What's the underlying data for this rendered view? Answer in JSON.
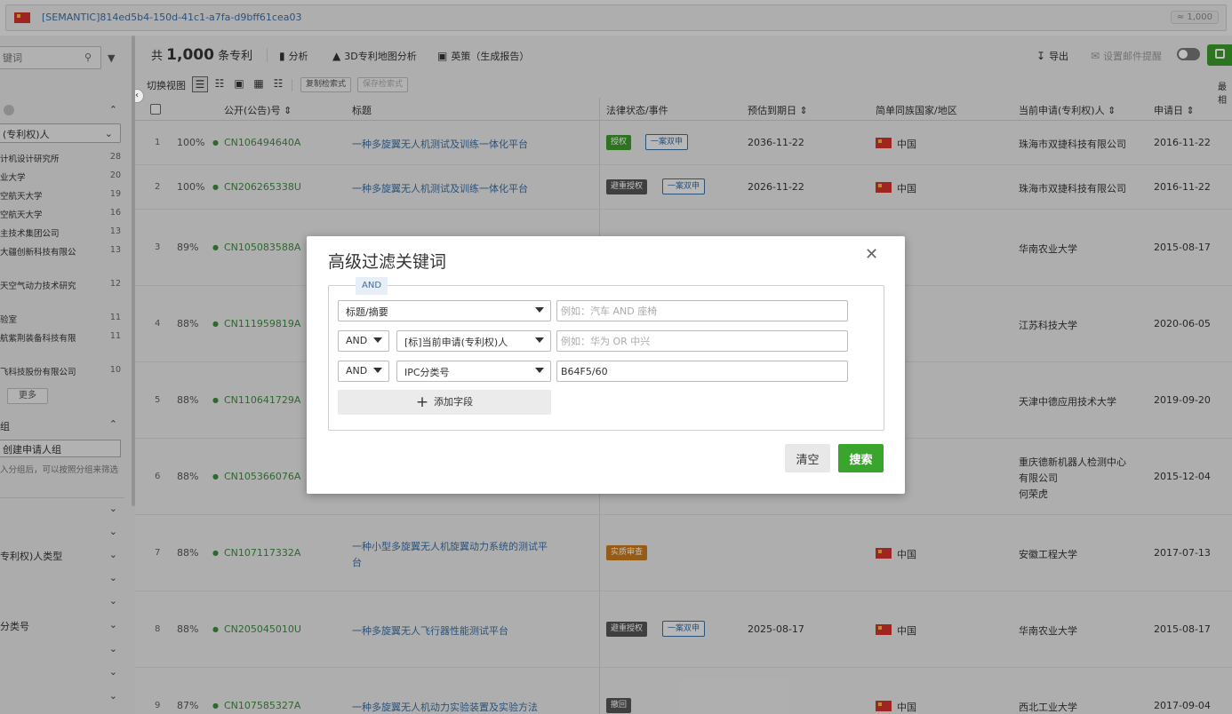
{
  "topbar": {
    "query": "[SEMANTIC]814ed5b4-150d-41c1-a7fa-d9bff61cea03",
    "count_badge": "≈ 1,000"
  },
  "sidebar": {
    "search_placeholder": "键词",
    "section1_title": "",
    "field_select": "(专利权)人",
    "items": [
      {
        "label": "计机设计研究所",
        "count": "28"
      },
      {
        "label": "业大学",
        "count": "20"
      },
      {
        "label": "空航天大学",
        "count": "19"
      },
      {
        "label": "空航天大学",
        "count": "16"
      },
      {
        "label": "主技术集团公司",
        "count": "13"
      },
      {
        "label": "大疆创新科技有限公",
        "count": "13"
      },
      {
        "label": "天空气动力技术研究",
        "count": "12"
      },
      {
        "label": "验室",
        "count": "11"
      },
      {
        "label": "航紫荆装备科技有限",
        "count": "11"
      },
      {
        "label": "飞科技股份有限公司",
        "count": "10"
      }
    ],
    "more_label": "更多",
    "group_title": "组",
    "group_input": "创建申请人组",
    "group_hint": "入分组后，可以按照分组来筛选",
    "collapsed": [
      "",
      "",
      "专利权)人类型",
      "",
      "",
      "分类号",
      "",
      "",
      ""
    ]
  },
  "toolbar": {
    "total_prefix": "共",
    "total_count": "1,000",
    "total_suffix": "条专利",
    "analysis": "分析",
    "map3d": "3D专利地图分析",
    "yingce": "英策（生成报告）",
    "export": "导出",
    "email_alert": "设置邮件提醒"
  },
  "viewbar": {
    "label": "切换视图",
    "copy_query": "复制检索式",
    "save_query": "保存检索式",
    "right_cut": "最相"
  },
  "table": {
    "headers": {
      "pn": "公开(公告)号",
      "title": "标题",
      "legal": "法律状态/事件",
      "expiry": "预估到期日",
      "family": "简单同族国家/地区",
      "applicant": "当前申请(专利权)人",
      "app_date": "申请日"
    },
    "rows": [
      {
        "idx": "1",
        "pct": "100%",
        "pn": "CN106494640A",
        "title": "一种多旋翼无人机测试及训练一体化平台",
        "title2": "",
        "tags": [
          {
            "t": "授权",
            "c": "green"
          },
          {
            "t": "一案双申",
            "c": "outline"
          }
        ],
        "expiry": "2036-11-22",
        "country": "中国",
        "applicant": [
          "珠海市双捷科技有限公司"
        ],
        "app_date": "2016-11-22"
      },
      {
        "idx": "2",
        "pct": "100%",
        "pn": "CN206265338U",
        "title": "一种多旋翼无人机测试及训练一体化平台",
        "title2": "",
        "tags": [
          {
            "t": "避重授权",
            "c": "gray"
          },
          {
            "t": "一案双申",
            "c": "outline"
          }
        ],
        "expiry": "2026-11-22",
        "country": "中国",
        "applicant": [
          "珠海市双捷科技有限公司"
        ],
        "app_date": "2016-11-22"
      },
      {
        "idx": "3",
        "pct": "89%",
        "pn": "CN105083588A",
        "title": "",
        "title2": "",
        "tags": [],
        "expiry": "",
        "country": "国",
        "applicant": [
          "华南农业大学"
        ],
        "app_date": "2015-08-17"
      },
      {
        "idx": "4",
        "pct": "88%",
        "pn": "CN111959819A",
        "title": "",
        "title2": "",
        "tags": [],
        "expiry": "",
        "country": "国",
        "applicant": [
          "江苏科技大学"
        ],
        "app_date": "2020-06-05"
      },
      {
        "idx": "5",
        "pct": "88%",
        "pn": "CN110641729A",
        "title": "",
        "title2": "",
        "tags": [],
        "expiry": "",
        "country": "国",
        "applicant": [
          "天津中德应用技术大学"
        ],
        "app_date": "2019-09-20"
      },
      {
        "idx": "6",
        "pct": "88%",
        "pn": "CN105366076A",
        "title": "",
        "title2": "",
        "tags": [],
        "expiry": "",
        "country": "国",
        "applicant": [
          "重庆德新机器人检测中心",
          "有限公司",
          "何荣虎"
        ],
        "app_date": "2015-12-04"
      },
      {
        "idx": "7",
        "pct": "88%",
        "pn": "CN107117332A",
        "title": "一种小型多旋翼无人机旋翼动力系统的测试平",
        "title2": "台",
        "tags": [
          {
            "t": "实质审查",
            "c": "orange"
          }
        ],
        "expiry": "",
        "country": "中国",
        "applicant": [
          "安徽工程大学"
        ],
        "app_date": "2017-07-13"
      },
      {
        "idx": "8",
        "pct": "88%",
        "pn": "CN205045010U",
        "title": "一种多旋翼无人飞行器性能测试平台",
        "title2": "",
        "tags": [
          {
            "t": "避重授权",
            "c": "gray"
          },
          {
            "t": "一案双申",
            "c": "outline"
          }
        ],
        "expiry": "2025-08-17",
        "country": "中国",
        "applicant": [
          "华南农业大学"
        ],
        "app_date": "2015-08-17"
      },
      {
        "idx": "9",
        "pct": "87%",
        "pn": "CN107585327A",
        "title": "一种多旋翼无人机动力实验装置及实验方法",
        "title2": "",
        "tags": [
          {
            "t": "撤回",
            "c": "gray"
          }
        ],
        "expiry": "",
        "country": "中国",
        "applicant": [
          "西北工业大学"
        ],
        "app_date": "2017-09-04"
      }
    ]
  },
  "modal": {
    "title": "高级过滤关键词",
    "and_chip": "AND",
    "rows": [
      {
        "op": "",
        "field": "标题/摘要",
        "value": "",
        "placeholder": "例如：汽车 AND 座椅"
      },
      {
        "op": "AND",
        "field": "[标]当前申请(专利权)人",
        "value": "",
        "placeholder": "例如：华为 OR 中兴"
      },
      {
        "op": "AND",
        "field": "IPC分类号",
        "value": "B64F5/60",
        "placeholder": ""
      }
    ],
    "add_field": "添加字段",
    "clear": "清空",
    "search": "搜索"
  },
  "colors": {
    "accent_green": "#3aa52c",
    "link_blue": "#3a6ea5",
    "pn_green": "#3d8b40"
  }
}
